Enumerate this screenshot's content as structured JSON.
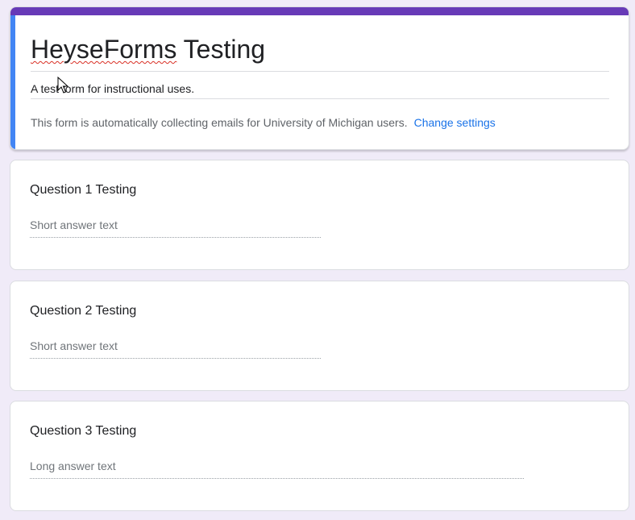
{
  "form": {
    "title_part1": "HeyseForms",
    "title_part2": " Testing",
    "description": "A test form for instructional uses.",
    "email_notice": "This form is automatically collecting emails for University of Michigan users.",
    "change_settings_label": "Change settings"
  },
  "questions": [
    {
      "title": "Question 1 Testing",
      "placeholder": "Short answer text",
      "type": "short"
    },
    {
      "title": "Question 2 Testing",
      "placeholder": "Short answer text",
      "type": "short"
    },
    {
      "title": "Question 3 Testing",
      "placeholder": "Long answer text",
      "type": "long"
    }
  ],
  "colors": {
    "background": "#f0ebf8",
    "accent_purple": "#673ab7",
    "accent_blue": "#4285f4",
    "link": "#1a73e8"
  },
  "icons": {
    "cursor": "mouse-pointer-icon"
  }
}
